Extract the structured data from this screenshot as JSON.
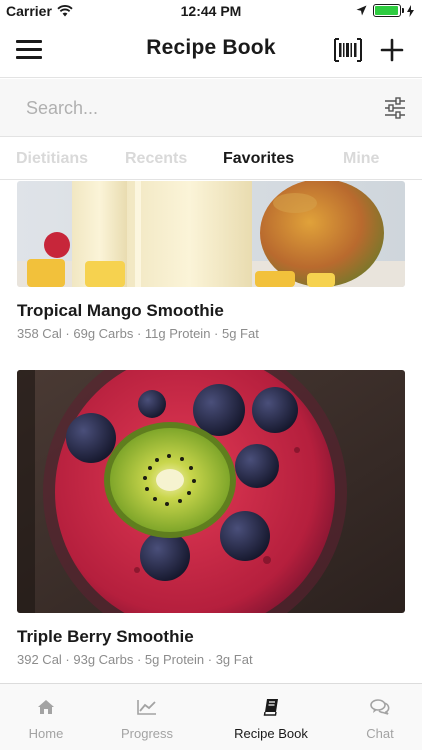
{
  "status_bar": {
    "carrier": "Carrier",
    "time": "12:44 PM",
    "battery_level": 0.95
  },
  "header": {
    "title": "Recipe Book",
    "menu_icon": "hamburger-menu-icon",
    "barcode_icon": "barcode-scan-icon",
    "add_icon": "plus-icon"
  },
  "search": {
    "placeholder": "Search...",
    "value": "",
    "filter_icon": "sliders-filter-icon"
  },
  "tabs": [
    {
      "label": "Dietitians",
      "active": false
    },
    {
      "label": "Recents",
      "active": false
    },
    {
      "label": "Favorites",
      "active": true
    },
    {
      "label": "Mine",
      "active": false
    }
  ],
  "recipes": [
    {
      "title": "Tropical Mango Smoothie",
      "meta": "358 Cal · 69g Carbs · 11g Protein · 5g Fat",
      "image": "mango-smoothie-photo"
    },
    {
      "title": "Triple Berry Smoothie",
      "meta": "392 Cal · 93g Carbs · 5g Protein · 3g Fat",
      "image": "berry-smoothie-photo"
    }
  ],
  "tab_bar": [
    {
      "label": "Home",
      "icon": "home-icon",
      "active": false
    },
    {
      "label": "Progress",
      "icon": "chart-line-icon",
      "active": false
    },
    {
      "label": "Recipe Book",
      "icon": "book-icon",
      "active": true
    },
    {
      "label": "Chat",
      "icon": "chat-bubbles-icon",
      "active": false
    }
  ],
  "colors": {
    "accent": "#1a1a1a",
    "inactive": "#a3a3a3",
    "battery": "#2ecc40"
  }
}
